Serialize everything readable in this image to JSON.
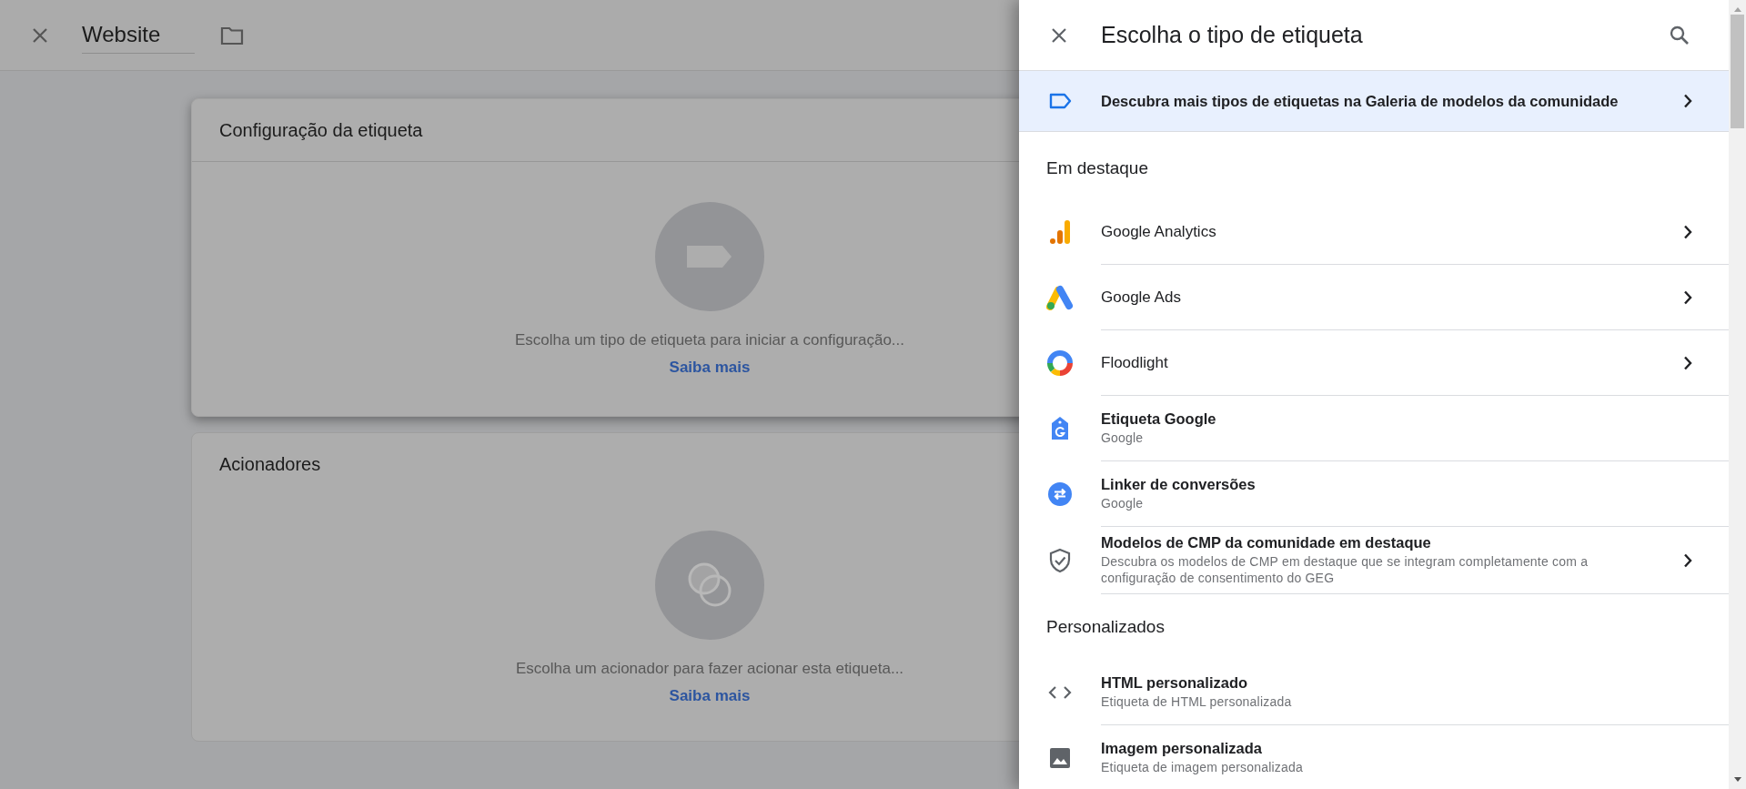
{
  "top_bar": {
    "name_value": "Website"
  },
  "cards": [
    {
      "kind": "tag",
      "title": "Configuração da etiqueta",
      "focused": true,
      "message": "Escolha um tipo de etiqueta para iniciar a configuração...",
      "link": "Saiba mais"
    },
    {
      "kind": "trigger",
      "title": "Acionadores",
      "focused": false,
      "message": "Escolha um acionador para fazer acionar esta etiqueta...",
      "link": "Saiba mais"
    }
  ],
  "panel": {
    "title": "Escolha o tipo de etiqueta",
    "gallery_banner": "Descubra mais tipos de etiquetas na Galeria de modelos da comunidade",
    "sections": [
      {
        "heading": "Em destaque",
        "items": [
          {
            "kind": "analytics",
            "title": "Google Analytics",
            "chevron": true
          },
          {
            "kind": "ads",
            "title": "Google Ads",
            "chevron": true
          },
          {
            "kind": "floodlight",
            "title": "Floodlight",
            "chevron": true
          },
          {
            "kind": "google-tag",
            "title": "Etiqueta Google",
            "subtitle": "Google",
            "chevron": false
          },
          {
            "kind": "linker",
            "title": "Linker de conversões",
            "subtitle": "Google",
            "chevron": false
          },
          {
            "kind": "shield",
            "title": "Modelos de CMP da comunidade em destaque",
            "subtitle": "Descubra os modelos de CMP em destaque que se integram completamente com a configuração de consentimento do GEG",
            "chevron": true
          }
        ]
      },
      {
        "heading": "Personalizados",
        "items": [
          {
            "kind": "code",
            "title": "HTML personalizado",
            "subtitle": "Etiqueta de HTML personalizada",
            "chevron": false
          },
          {
            "kind": "image",
            "title": "Imagem personalizada",
            "subtitle": "Etiqueta de imagem personalizada",
            "chevron": false
          }
        ]
      }
    ]
  }
}
